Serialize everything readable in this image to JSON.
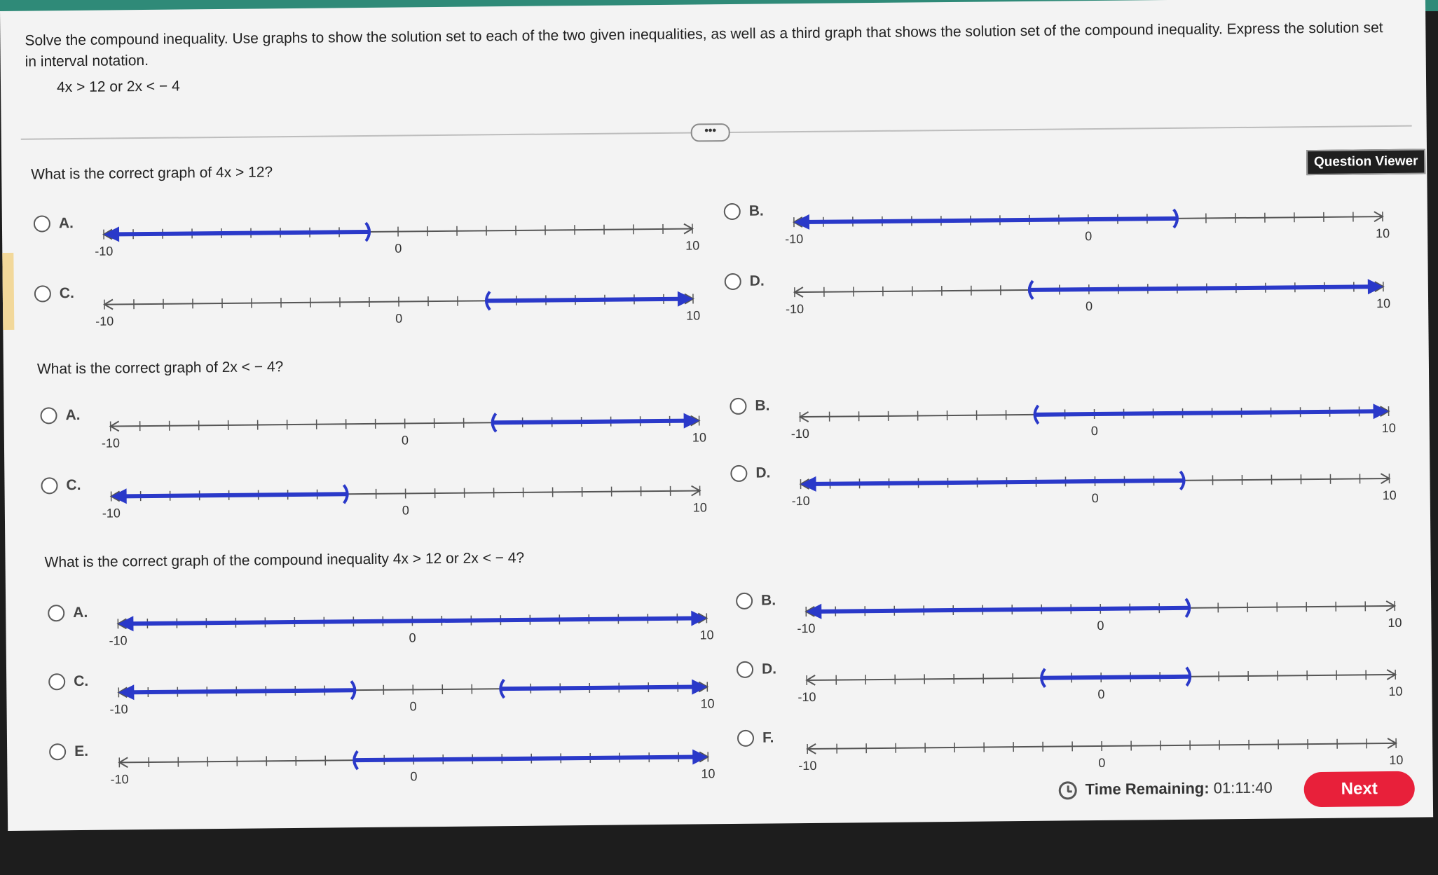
{
  "instructions": "Solve the compound inequality. Use graphs to show the solution set to each of the two given inequalities, as well as a third graph that shows the solution set of the compound inequality. Express the solution set in interval notation.",
  "expression": "4x > 12 or 2x < − 4",
  "more_button": "•••",
  "question_viewer": "Question Viewer",
  "questions": [
    {
      "text": "What is the correct graph of 4x > 12?",
      "options": [
        {
          "label": "A.",
          "shading": [
            {
              "from": -10,
              "to": -1,
              "arrow_left": true,
              "arrow_right": false,
              "end": "paren"
            }
          ],
          "ticks": [
            "-10",
            "0",
            "10"
          ]
        },
        {
          "label": "B.",
          "shading": [
            {
              "from": -10,
              "to": 3,
              "arrow_left": true,
              "arrow_right": false,
              "end": "paren"
            }
          ],
          "ticks": [
            "-10",
            "0",
            "10"
          ]
        },
        {
          "label": "C.",
          "shading": [
            {
              "from": 3,
              "to": 10,
              "arrow_left": false,
              "arrow_right": true,
              "start": "paren"
            }
          ],
          "ticks": [
            "-10",
            "0",
            "10"
          ]
        },
        {
          "label": "D.",
          "shading": [
            {
              "from": -2,
              "to": 10,
              "arrow_left": false,
              "arrow_right": true,
              "start": "paren"
            }
          ],
          "ticks": [
            "-10",
            "0",
            "10"
          ]
        }
      ]
    },
    {
      "text": "What is the correct graph of 2x < − 4?",
      "options": [
        {
          "label": "A.",
          "shading": [
            {
              "from": 3,
              "to": 10,
              "arrow_left": false,
              "arrow_right": true,
              "start": "paren"
            }
          ],
          "ticks": [
            "-10",
            "0",
            "10"
          ]
        },
        {
          "label": "B.",
          "shading": [
            {
              "from": -2,
              "to": 10,
              "arrow_left": false,
              "arrow_right": true,
              "start": "paren"
            }
          ],
          "ticks": [
            "-10",
            "0",
            "10"
          ]
        },
        {
          "label": "C.",
          "shading": [
            {
              "from": -10,
              "to": -2,
              "arrow_left": true,
              "arrow_right": false,
              "end": "paren"
            }
          ],
          "ticks": [
            "-10",
            "0",
            "10"
          ]
        },
        {
          "label": "D.",
          "shading": [
            {
              "from": -10,
              "to": 3,
              "arrow_left": true,
              "arrow_right": false,
              "end": "paren"
            }
          ],
          "ticks": [
            "-10",
            "0",
            "10"
          ]
        }
      ]
    },
    {
      "text": "What is the correct graph of the compound inequality 4x > 12 or 2x < − 4?",
      "options": [
        {
          "label": "A.",
          "shading": [
            {
              "from": -10,
              "to": 10,
              "arrow_left": true,
              "arrow_right": true
            }
          ],
          "ticks": [
            "-10",
            "0",
            "10"
          ]
        },
        {
          "label": "B.",
          "shading": [
            {
              "from": -10,
              "to": 3,
              "arrow_left": true,
              "arrow_right": false,
              "end": "paren"
            }
          ],
          "ticks": [
            "-10",
            "0",
            "10"
          ]
        },
        {
          "label": "C.",
          "shading": [
            {
              "from": -10,
              "to": -2,
              "arrow_left": true,
              "arrow_right": false,
              "end": "paren"
            },
            {
              "from": 3,
              "to": 10,
              "arrow_left": false,
              "arrow_right": true,
              "start": "paren"
            }
          ],
          "ticks": [
            "-10",
            "0",
            "10"
          ]
        },
        {
          "label": "D.",
          "shading": [
            {
              "from": -2,
              "to": 3,
              "arrow_left": false,
              "arrow_right": false,
              "start": "paren",
              "end": "paren"
            }
          ],
          "ticks": [
            "-10",
            "0",
            "10"
          ]
        },
        {
          "label": "E.",
          "shading": [
            {
              "from": -2,
              "to": 10,
              "arrow_left": false,
              "arrow_right": true,
              "start": "paren"
            }
          ],
          "ticks": [
            "-10",
            "0",
            "10"
          ]
        },
        {
          "label": "F.",
          "shading": [],
          "ticks": [
            "-10",
            "0",
            "10"
          ]
        }
      ]
    }
  ],
  "footer": {
    "time_label": "Time Remaining:",
    "time_value": "01:11:40",
    "next_label": "Next"
  },
  "colors": {
    "shade": "#2a39c9",
    "axis": "#555555",
    "next": "#e8203a"
  }
}
